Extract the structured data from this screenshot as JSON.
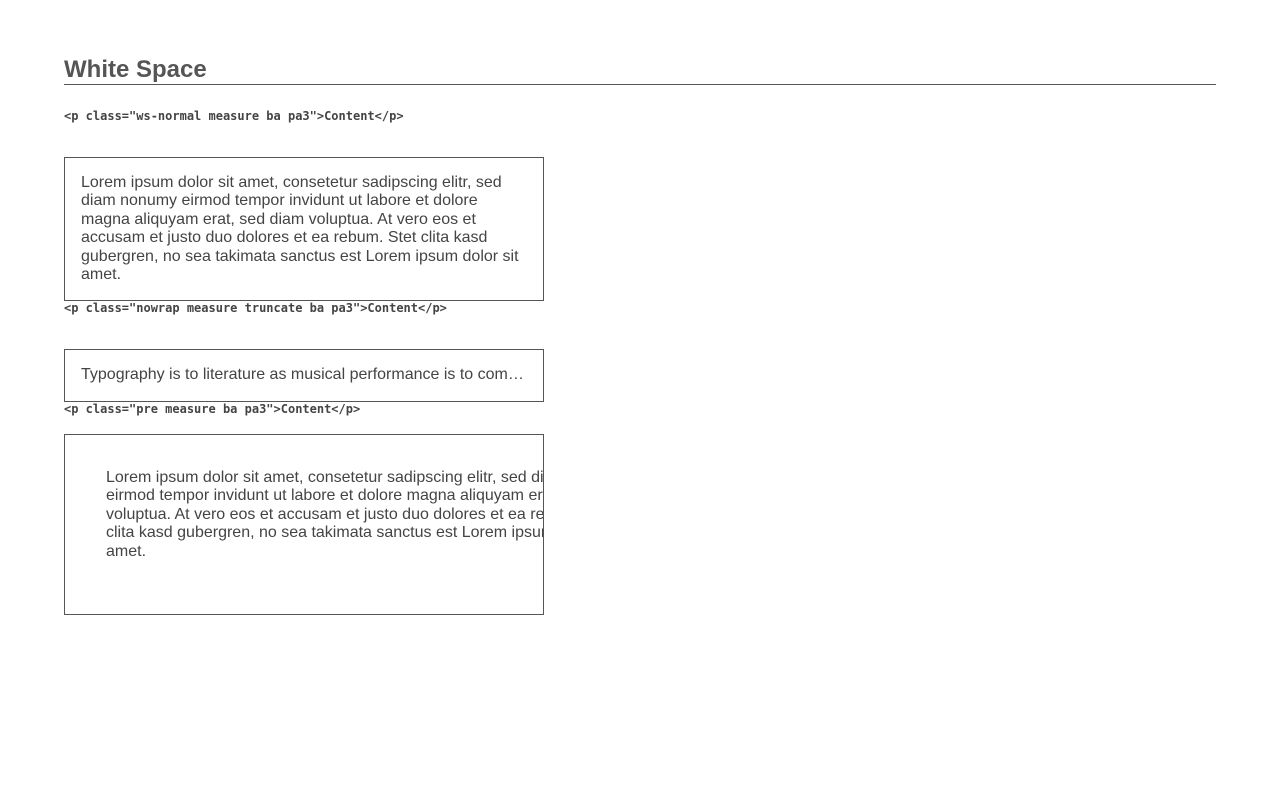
{
  "section": {
    "title": "White Space"
  },
  "examples": [
    {
      "code": "<p class=\"ws-normal measure ba pa3\">Content</p>",
      "text": "Lorem ipsum dolor sit amet, consetetur sadipscing elitr, sed diam nonumy eirmod tempor invidunt ut labore et dolore magna aliquyam erat, sed diam voluptua. At vero eos et accusam et justo duo dolores et ea rebum. Stet clita kasd gubergren, no sea takimata sanctus est Lorem ipsum dolor sit amet."
    },
    {
      "code": "<p class=\"nowrap measure truncate ba pa3\">Content</p>",
      "text": "Typography is to literature as musical performance is to composition: an essential act of interpretation, full of endless opportunities for insight or obtuseness."
    },
    {
      "code": "<p class=\"pre measure ba pa3\">Content</p>",
      "lines": [
        "Lorem ipsum dolor sit amet, consetetur sadipscing elitr, sed diam nonumy",
        "eirmod tempor invidunt ut labore et dolore magna aliquyam erat, sed diam",
        "voluptua. At vero eos et accusam et justo duo dolores et ea rebum. Stet",
        "clita kasd gubergren, no sea takimata sanctus est Lorem ipsum dolor sit",
        "amet."
      ]
    }
  ]
}
